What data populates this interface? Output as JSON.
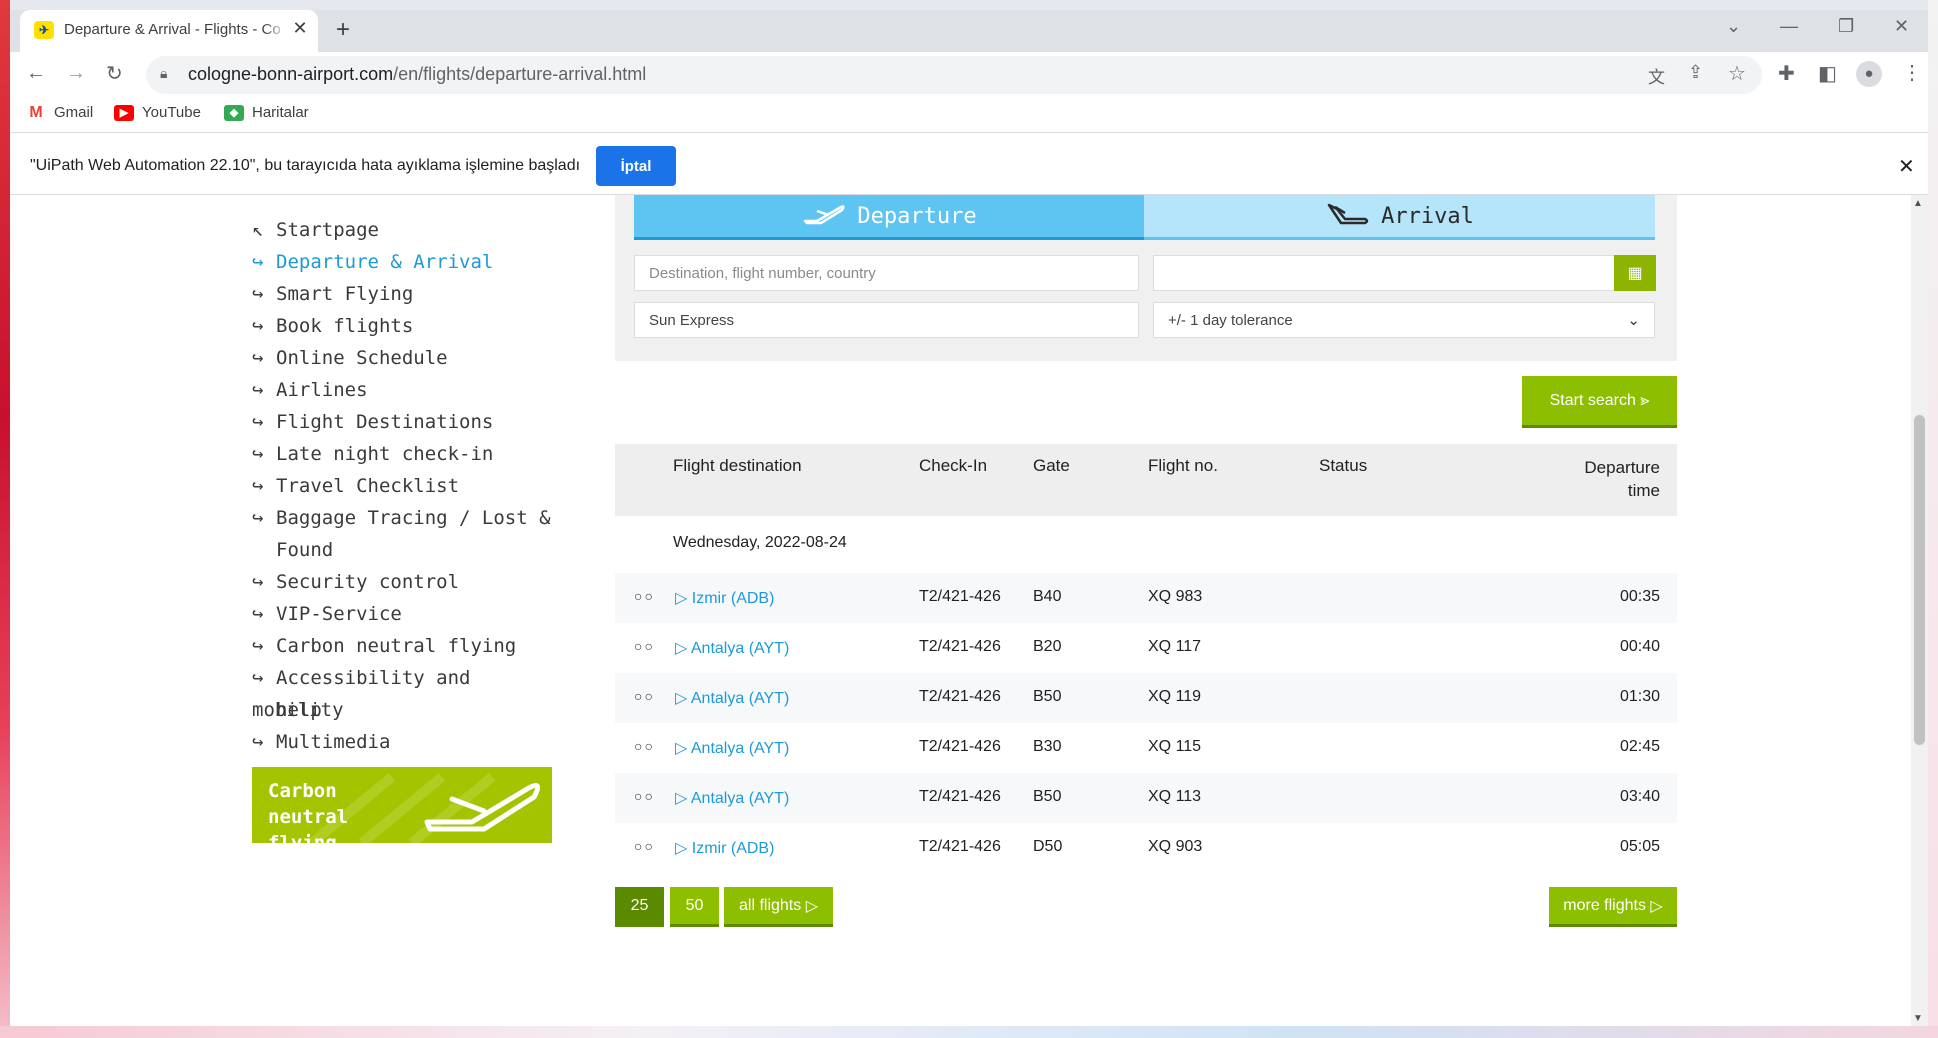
{
  "browser": {
    "tab_title": "Departure & Arrival - Flights - Co",
    "url_host": "cologne-bonn-airport.com",
    "url_path": "/en/flights/departure-arrival.html",
    "bookmarks": [
      "Gmail",
      "YouTube",
      "Haritalar"
    ]
  },
  "infobar": {
    "message": "\"UiPath Web Automation 22.10\", bu tarayıcıda hata ayıklama işlemine başladı",
    "cancel_label": "İptal"
  },
  "nav": {
    "items": [
      "Startpage",
      "Departure & Arrival",
      "Smart Flying",
      "Book flights",
      "Online Schedule",
      "Airlines",
      "Flight Destinations",
      "Late night check-in",
      "Travel Checklist",
      "Baggage Tracing / Lost &",
      "Found",
      "Security control",
      "VIP-Service",
      "Carbon neutral flying",
      "Accessibility and mobility",
      "help",
      "Multimedia"
    ],
    "banner_line1": "Carbon neutral",
    "banner_line2": "flying"
  },
  "search": {
    "tab_departure": "Departure",
    "tab_arrival": "Arrival",
    "destination_placeholder": "Destination, flight number, country",
    "date_value": "",
    "airline_value": "Sun Express",
    "tolerance_value": "+/- 1 day tolerance",
    "start_label": "Start search"
  },
  "table": {
    "headers": {
      "destination": "Flight destination",
      "checkin": "Check-In",
      "gate": "Gate",
      "flight_no": "Flight no.",
      "status": "Status",
      "departure_1": "Departure",
      "departure_2": "time"
    },
    "date_label": "Wednesday, 2022-08-24",
    "rows": [
      {
        "destination": "Izmir (ADB)",
        "checkin": "T2/421-426",
        "gate": "B40",
        "flight": "XQ 983",
        "status": "",
        "time": "00:35"
      },
      {
        "destination": "Antalya (AYT)",
        "checkin": "T2/421-426",
        "gate": "B20",
        "flight": "XQ 117",
        "status": "",
        "time": "00:40"
      },
      {
        "destination": "Antalya (AYT)",
        "checkin": "T2/421-426",
        "gate": "B50",
        "flight": "XQ 119",
        "status": "",
        "time": "01:30"
      },
      {
        "destination": "Antalya (AYT)",
        "checkin": "T2/421-426",
        "gate": "B30",
        "flight": "XQ 115",
        "status": "",
        "time": "02:45"
      },
      {
        "destination": "Antalya (AYT)",
        "checkin": "T2/421-426",
        "gate": "B50",
        "flight": "XQ 113",
        "status": "",
        "time": "03:40"
      },
      {
        "destination": "Izmir (ADB)",
        "checkin": "T2/421-426",
        "gate": "D50",
        "flight": "XQ 903",
        "status": "",
        "time": "05:05"
      }
    ]
  },
  "pagination": {
    "p25": "25",
    "p50": "50",
    "all": "all flights",
    "more": "more flights"
  },
  "colors": {
    "accent_blue": "#1e9ad6",
    "accent_green": "#8dbf00",
    "infobar_button": "#1a73e8"
  }
}
